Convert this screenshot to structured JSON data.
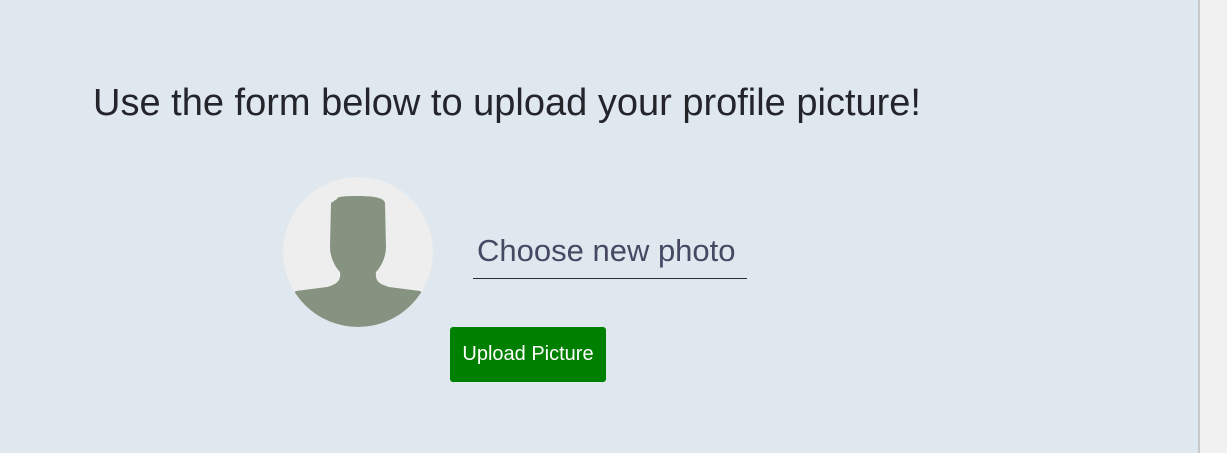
{
  "page": {
    "heading": "Use the form below to upload your profile picture!"
  },
  "avatar": {
    "icon": "default-user-silhouette-icon",
    "background_color": "#eeeeee",
    "silhouette_color": "#879381"
  },
  "form": {
    "choose_photo_label": "Choose new photo",
    "upload_button_label": "Upload Picture",
    "upload_button_color": "#008000"
  }
}
